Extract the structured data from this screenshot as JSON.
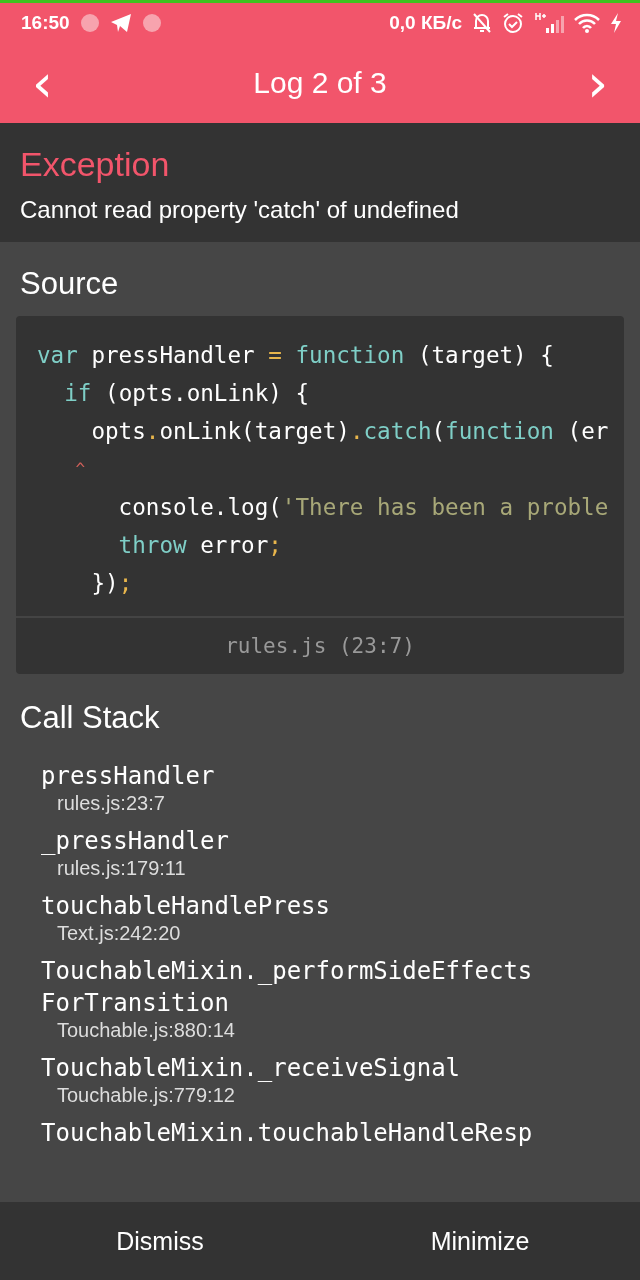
{
  "status_bar": {
    "time": "16:50",
    "speed": "0,0 КБ/с"
  },
  "header": {
    "prev": "‹",
    "title": "Log 2 of 3",
    "next": "›"
  },
  "exception": {
    "title": "Exception",
    "message": "Cannot read property 'catch' of undefined"
  },
  "source": {
    "title": "Source",
    "lines": [
      [
        {
          "text": "var",
          "kind": "keyword"
        },
        {
          "text": " pressHandler ",
          "kind": "plain"
        },
        {
          "text": "=",
          "kind": "punct"
        },
        {
          "text": " function",
          "kind": "keyword"
        },
        {
          "text": " (target) {",
          "kind": "plain"
        }
      ],
      [
        {
          "text": "  if",
          "kind": "keyword"
        },
        {
          "text": " (opts.onLink) {",
          "kind": "plain"
        }
      ],
      [
        {
          "text": "    opts",
          "kind": "plain"
        },
        {
          "text": ".",
          "kind": "punct"
        },
        {
          "text": "onLink(target)",
          "kind": "plain"
        },
        {
          "text": ".",
          "kind": "punct"
        },
        {
          "text": "catch",
          "kind": "keyword"
        },
        {
          "text": "(",
          "kind": "plain"
        },
        {
          "text": "function",
          "kind": "keyword"
        },
        {
          "text": " (er",
          "kind": "plain"
        }
      ],
      [
        {
          "text": "    ^",
          "kind": "marker"
        }
      ],
      [
        {
          "text": "      console.log(",
          "kind": "plain"
        },
        {
          "text": "'There has been a proble",
          "kind": "string"
        }
      ],
      [
        {
          "text": "      throw",
          "kind": "keyword"
        },
        {
          "text": " error",
          "kind": "plain"
        },
        {
          "text": ";",
          "kind": "punct"
        }
      ],
      [
        {
          "text": "    })",
          "kind": "plain"
        },
        {
          "text": ";",
          "kind": "punct"
        }
      ]
    ],
    "location": "rules.js (23:7)"
  },
  "call_stack": {
    "title": "Call Stack",
    "frames": [
      {
        "method": "pressHandler",
        "file": "rules.js:23:7"
      },
      {
        "method": "_pressHandler",
        "file": "rules.js:179:11"
      },
      {
        "method": "touchableHandlePress",
        "file": "Text.js:242:20"
      },
      {
        "method": "TouchableMixin._performSideEffects ForTransition",
        "file": "Touchable.js:880:14"
      },
      {
        "method": "TouchableMixin._receiveSignal",
        "file": "Touchable.js:779:12"
      },
      {
        "method": "TouchableMixin.touchableHandleResp"
      }
    ]
  },
  "buttons": [
    "Dismiss",
    "Minimize"
  ]
}
